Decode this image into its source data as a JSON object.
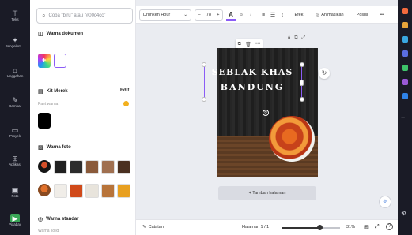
{
  "rail": {
    "items": [
      {
        "icon": "⊤",
        "label": "Teks"
      },
      {
        "icon": "✦",
        "label": "Pengelom…"
      },
      {
        "icon": "⌂",
        "label": "Unggahan"
      },
      {
        "icon": "✎",
        "label": "Gambar"
      },
      {
        "icon": "▭",
        "label": "Proyek"
      },
      {
        "icon": "⊞",
        "label": "Aplikasi"
      },
      {
        "icon": "▣",
        "label": "Foto"
      },
      {
        "icon": "▶",
        "label": "Pixabay"
      }
    ]
  },
  "panel": {
    "search_placeholder": "Coba \"biru\" atau \"#00c4cc\"",
    "doc_colors_title": "Warna dokumen",
    "brand_kit_title": "Kit Merek",
    "brand_kit_edit": "Edit",
    "brand_kit_sub": "Paet warna",
    "photo_colors_title": "Warna foto",
    "default_colors_title": "Warna standar",
    "default_colors_sub": "Warna solid",
    "photo_colors": [
      "#101010",
      "#202020",
      "#2c2c2c",
      "#8a5a3a",
      "#a07050",
      "#4a3020",
      "#c8652a",
      "#f0ede8",
      "#d04a1a",
      "#e8e4dc",
      "#b8743a",
      "#e8a020"
    ]
  },
  "toolbar": {
    "font": "Drunken Hour",
    "font_size": "78",
    "effects": "Efek",
    "animate": "Animasikan",
    "position": "Posisi",
    "more": "•••"
  },
  "canvas": {
    "title_line1": "SEBLAK KHAS",
    "title_line2": "BANDUNG",
    "add_page": "+ Tambah halaman"
  },
  "footer": {
    "notes": "Catatan",
    "page_indicator": "Halaman 1 / 1",
    "zoom": "31%",
    "zoom_level": 0.31
  },
  "colors": {
    "accent": "#8b5cf6",
    "rail_bg": "#1a1b26"
  }
}
